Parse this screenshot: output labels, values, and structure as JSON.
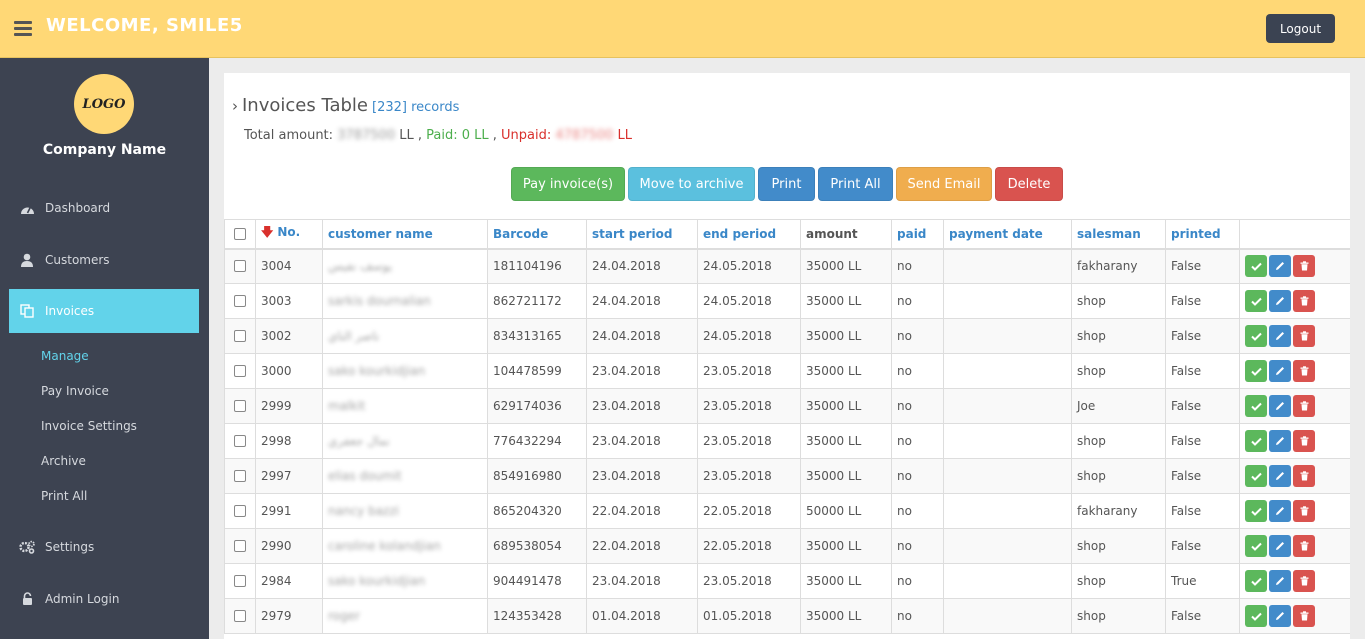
{
  "header": {
    "welcome": "WELCOME, SMILE5",
    "logout_label": "Logout"
  },
  "sidebar": {
    "logo": "LOGO",
    "company_name": "Company Name",
    "items": [
      {
        "label": "Dashboard",
        "icon": "dashboard-icon"
      },
      {
        "label": "Customers",
        "icon": "user-icon"
      },
      {
        "label": "Invoices",
        "icon": "copy-icon"
      },
      {
        "label": "Settings",
        "icon": "gears-icon"
      },
      {
        "label": "Admin Login",
        "icon": "lock-icon"
      }
    ],
    "sub_items": [
      "Manage",
      "Pay Invoice",
      "Invoice Settings",
      "Archive",
      "Print All"
    ]
  },
  "main": {
    "title": "Invoices Table",
    "records": "[232] records",
    "total_label": "Total amount:",
    "total_value": "3787500",
    "currency": "LL",
    "paid_label": "Paid: 0 LL",
    "unpaid_label": "Unpaid:",
    "unpaid_value": "4787500",
    "buttons": {
      "pay": "Pay invoice(s)",
      "archive": "Move to archive",
      "print": "Print",
      "print_all": "Print All",
      "email": "Send Email",
      "delete": "Delete"
    },
    "table": {
      "columns": [
        "No.",
        "customer name",
        "Barcode",
        "start period",
        "end period",
        "amount",
        "paid",
        "payment date",
        "salesman",
        "printed"
      ],
      "rows": [
        {
          "no": "3004",
          "customer": "يوسف نفيس",
          "barcode": "181104196",
          "start": "24.04.2018",
          "end": "24.05.2018",
          "amount": "35000 LL",
          "paid": "no",
          "payment_date": "",
          "salesman": "fakharany",
          "printed": "False"
        },
        {
          "no": "3003",
          "customer": "sarkis dournalian",
          "barcode": "862721172",
          "start": "24.04.2018",
          "end": "24.05.2018",
          "amount": "35000 LL",
          "paid": "no",
          "payment_date": "",
          "salesman": "shop",
          "printed": "False"
        },
        {
          "no": "3002",
          "customer": "ناصر الناي",
          "barcode": "834313165",
          "start": "24.04.2018",
          "end": "24.05.2018",
          "amount": "35000 LL",
          "paid": "no",
          "payment_date": "",
          "salesman": "shop",
          "printed": "False"
        },
        {
          "no": "3000",
          "customer": "sako kourkidjian",
          "barcode": "104478599",
          "start": "23.04.2018",
          "end": "23.05.2018",
          "amount": "35000 LL",
          "paid": "no",
          "payment_date": "",
          "salesman": "shop",
          "printed": "False"
        },
        {
          "no": "2999",
          "customer": "malkit",
          "barcode": "629174036",
          "start": "23.04.2018",
          "end": "23.05.2018",
          "amount": "35000 LL",
          "paid": "no",
          "payment_date": "",
          "salesman": "Joe",
          "printed": "False"
        },
        {
          "no": "2998",
          "customer": "نمال جعفري",
          "barcode": "776432294",
          "start": "23.04.2018",
          "end": "23.05.2018",
          "amount": "35000 LL",
          "paid": "no",
          "payment_date": "",
          "salesman": "shop",
          "printed": "False"
        },
        {
          "no": "2997",
          "customer": "elias doumit",
          "barcode": "854916980",
          "start": "23.04.2018",
          "end": "23.05.2018",
          "amount": "35000 LL",
          "paid": "no",
          "payment_date": "",
          "salesman": "shop",
          "printed": "False"
        },
        {
          "no": "2991",
          "customer": "nancy bazzi",
          "barcode": "865204320",
          "start": "22.04.2018",
          "end": "22.05.2018",
          "amount": "50000 LL",
          "paid": "no",
          "payment_date": "",
          "salesman": "fakharany",
          "printed": "False"
        },
        {
          "no": "2990",
          "customer": "caroline kolandjian",
          "barcode": "689538054",
          "start": "22.04.2018",
          "end": "22.05.2018",
          "amount": "35000 LL",
          "paid": "no",
          "payment_date": "",
          "salesman": "shop",
          "printed": "False"
        },
        {
          "no": "2984",
          "customer": "sako kourkidjian",
          "barcode": "904491478",
          "start": "23.04.2018",
          "end": "23.05.2018",
          "amount": "35000 LL",
          "paid": "no",
          "payment_date": "",
          "salesman": "shop",
          "printed": "True"
        },
        {
          "no": "2979",
          "customer": "roger",
          "barcode": "124353428",
          "start": "01.04.2018",
          "end": "01.05.2018",
          "amount": "35000 LL",
          "paid": "no",
          "payment_date": "",
          "salesman": "shop",
          "printed": "False"
        }
      ]
    }
  },
  "colors": {
    "topbar": "#ffd876",
    "sidebar": "#3d4351",
    "active": "#62d3ea",
    "btn_pay": "#5cb85c",
    "btn_archive": "#5bc0de",
    "btn_print": "#428bca",
    "btn_email": "#f0ad4e",
    "btn_delete": "#d9534f"
  }
}
